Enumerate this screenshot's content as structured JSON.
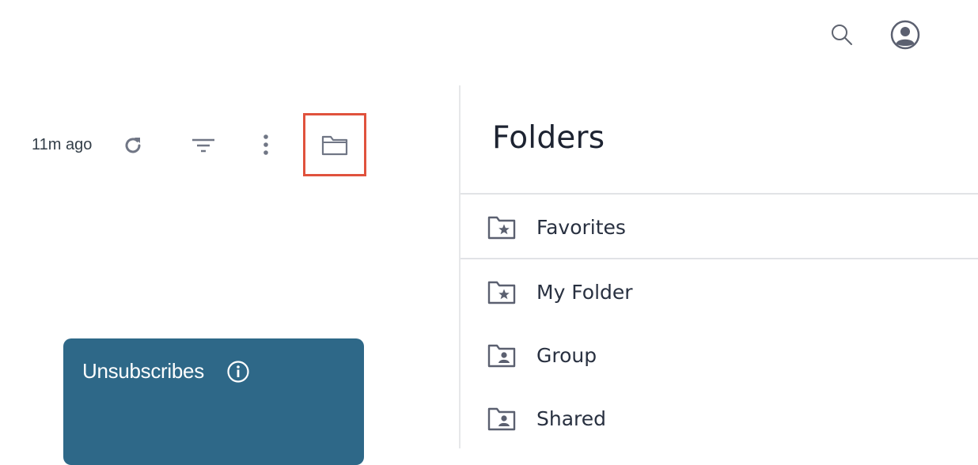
{
  "topbar": {
    "search_icon": "search-icon",
    "account_icon": "account-circle-icon"
  },
  "toolbar": {
    "updated_text": "11m ago",
    "refresh_icon": "refresh-icon",
    "filter_icon": "filter-icon",
    "more_icon": "more-vertical-icon",
    "folder_icon": "folder-icon",
    "highlight_color": "#e0523d"
  },
  "folders_panel": {
    "title": "Folders",
    "items": [
      {
        "label": "Favorites",
        "icon": "folder-star-icon"
      },
      {
        "label": "My Folder",
        "icon": "folder-star-icon"
      },
      {
        "label": "Group",
        "icon": "folder-person-icon"
      },
      {
        "label": "Shared",
        "icon": "folder-person-icon"
      }
    ]
  },
  "cards": [
    {
      "title": "Unsubscribes",
      "icon": "info-icon",
      "color": "#2e6888"
    }
  ]
}
